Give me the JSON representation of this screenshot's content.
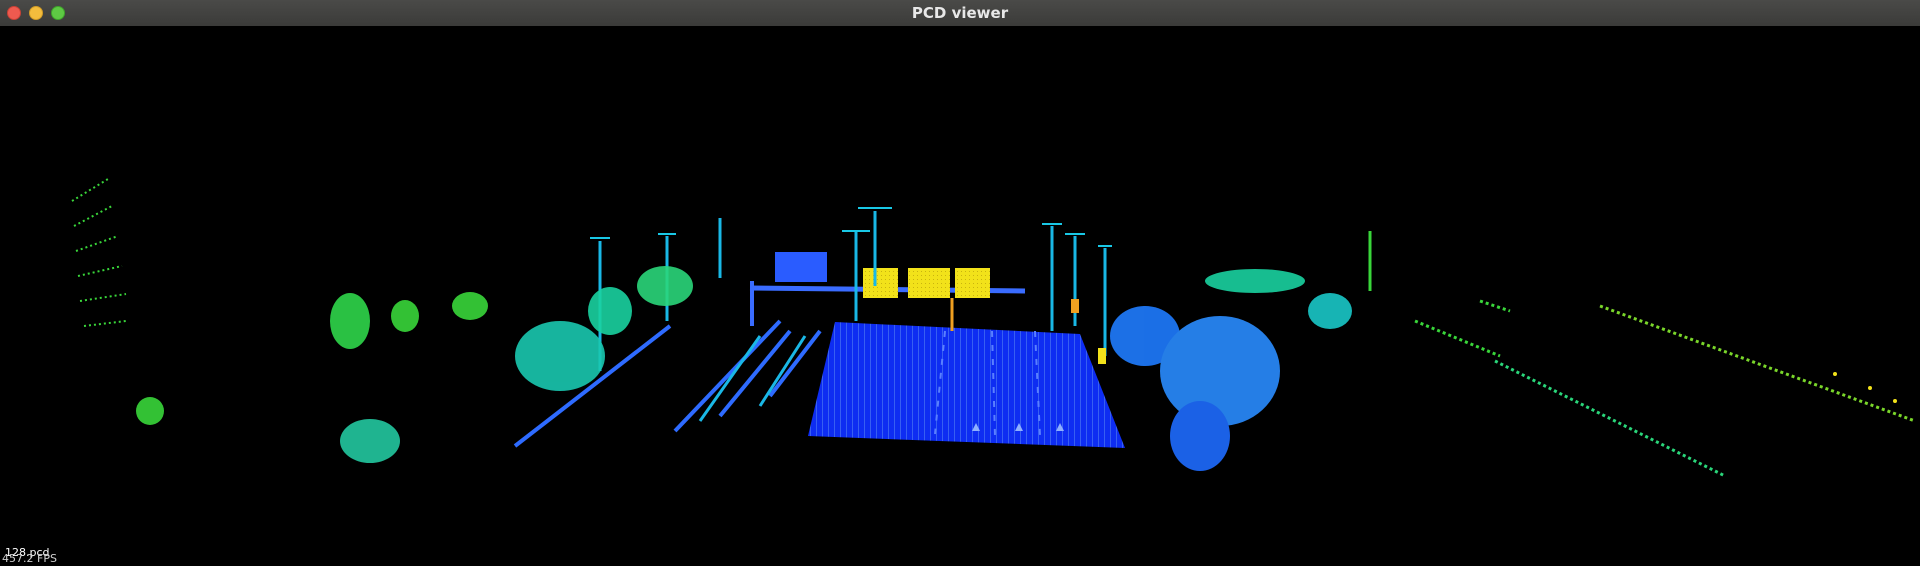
{
  "window": {
    "title": "PCD viewer"
  },
  "viewport": {
    "background_color": "#000000",
    "file_name": "128.pcd",
    "fps_text": "457.2 FPS"
  },
  "colormap": {
    "near_blue": "#0a2cff",
    "blue": "#1f5bff",
    "cyan": "#19c8e6",
    "teal": "#1ad2a0",
    "green": "#39d63a",
    "yellow": "#f2e21a",
    "orange": "#f0a020"
  }
}
